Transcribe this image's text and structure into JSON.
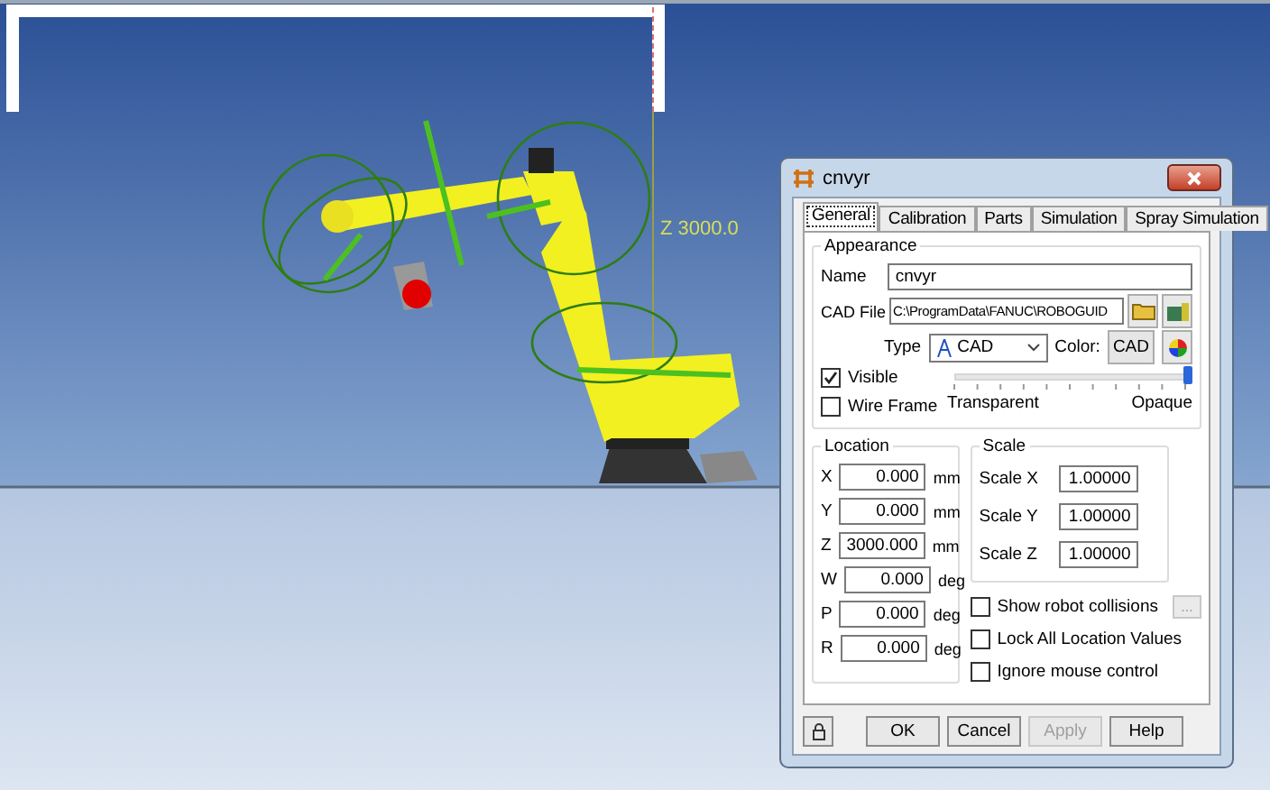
{
  "viewport": {
    "dimension_label": "Z 3000.0"
  },
  "dialog": {
    "title": "cnvyr",
    "tabs": [
      {
        "label": "General",
        "selected": true
      },
      {
        "label": "Calibration",
        "selected": false
      },
      {
        "label": "Parts",
        "selected": false
      },
      {
        "label": "Simulation",
        "selected": false
      },
      {
        "label": "Spray Simulation",
        "selected": false
      }
    ],
    "appearance": {
      "title": "Appearance",
      "name_label": "Name",
      "name_value": "cnvyr",
      "cad_file_label": "CAD File",
      "cad_file_value": "C:\\ProgramData\\FANUC\\ROBOGUID",
      "type_label": "Type",
      "type_value": "CAD",
      "color_label": "Color:",
      "color_button": "CAD",
      "checks": [
        {
          "label": "Visible",
          "checked": true
        },
        {
          "label": "Wire Frame",
          "checked": false
        }
      ],
      "opacity": {
        "level": 1,
        "min_label": "Transparent",
        "max_label": "Opaque"
      }
    },
    "location": {
      "title": "Location",
      "rows": [
        {
          "label": "X",
          "value": "0.000",
          "unit": "mm"
        },
        {
          "label": "Y",
          "value": "0.000",
          "unit": "mm"
        },
        {
          "label": "Z",
          "value": "3000.000",
          "unit": "mm"
        },
        {
          "label": "W",
          "value": "0.000",
          "unit": "deg"
        },
        {
          "label": "P",
          "value": "0.000",
          "unit": "deg"
        },
        {
          "label": "R",
          "value": "0.000",
          "unit": "deg"
        }
      ]
    },
    "scale": {
      "title": "Scale",
      "rows": [
        {
          "label": "Scale X",
          "value": "1.00000"
        },
        {
          "label": "Scale Y",
          "value": "1.00000"
        },
        {
          "label": "Scale Z",
          "value": "1.00000"
        }
      ]
    },
    "options": [
      {
        "label": "Show robot collisions",
        "checked": false,
        "kind": "with-button",
        "button": "..."
      },
      {
        "label": "Lock All Location Values",
        "checked": false,
        "kind": "plain"
      },
      {
        "label": "Ignore mouse control",
        "checked": false,
        "kind": "plain"
      }
    ],
    "buttons": [
      {
        "label": "OK",
        "disabled": false
      },
      {
        "label": "Cancel",
        "disabled": false
      },
      {
        "label": "Apply",
        "disabled": true
      },
      {
        "label": "Help",
        "disabled": false
      }
    ]
  }
}
